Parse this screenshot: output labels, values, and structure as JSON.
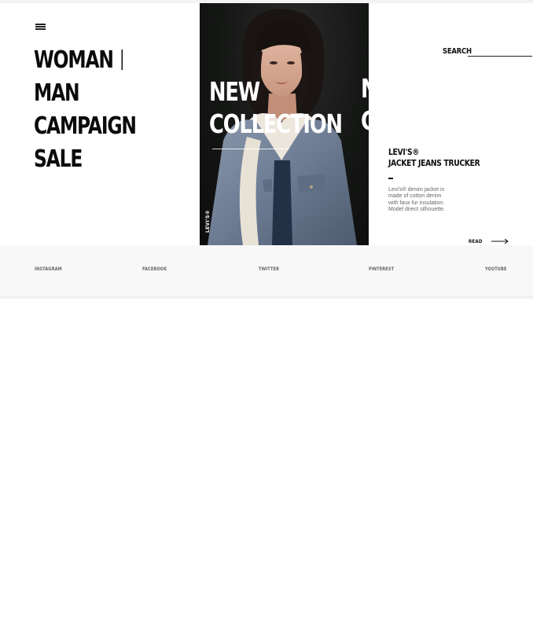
{
  "nav": {
    "items": [
      {
        "label": "WOMAN",
        "active": true
      },
      {
        "label": "MAN",
        "active": false
      },
      {
        "label": "CAMPAIGN",
        "active": false
      },
      {
        "label": "SALE",
        "active": false
      }
    ]
  },
  "hero": {
    "title_line1": "NEW",
    "title_line2": "COLLECTION",
    "brand_vertical": "LEVI'S®",
    "next_line1": "N",
    "next_line2": "C"
  },
  "search": {
    "label": "SEARCH",
    "value": ""
  },
  "product": {
    "brand": "LEVI'S®",
    "name": "JACKET JEANS TRUCKER",
    "description": "Levi's® denim jacket is made of cotton denim with faux fur insulation. Model direct silhouette.",
    "read_label": "READ"
  },
  "social": {
    "instagram": "INSTAGRAM",
    "facebook": "FACEBOOK",
    "twitter": "TWITTER",
    "pinterest": "PINTEREST",
    "youtube": "YOUTUBE"
  },
  "colors": {
    "text": "#0b0b0b",
    "hero_bg": "#151715",
    "social_bar_bg": "#f8f8f8",
    "muted_text": "#666666"
  },
  "icons": {
    "menu": "hamburger-icon",
    "read": "arrow-right-icon"
  }
}
